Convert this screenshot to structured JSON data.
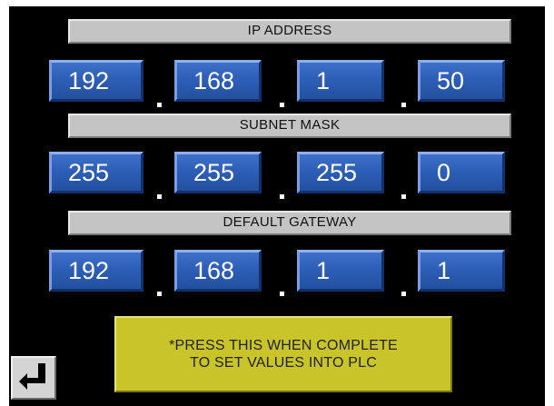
{
  "ip_address": {
    "label": "IP ADDRESS",
    "octets": [
      "192",
      "168",
      "1",
      "50"
    ]
  },
  "subnet_mask": {
    "label": "SUBNET MASK",
    "octets": [
      "255",
      "255",
      "255",
      "0"
    ]
  },
  "default_gateway": {
    "label": "DEFAULT GATEWAY",
    "octets": [
      "192",
      "168",
      "1",
      "1"
    ]
  },
  "complete_button": {
    "line1": "*PRESS THIS WHEN COMPLETE",
    "line2": "TO SET VALUES INTO PLC"
  },
  "enter_button": {
    "icon": "enter-return-icon"
  },
  "colors": {
    "screen_background": "#000000",
    "label_bar": "#c4c4c4",
    "octet_button": "#2d5fb8",
    "complete_button": "#c8c42a"
  }
}
